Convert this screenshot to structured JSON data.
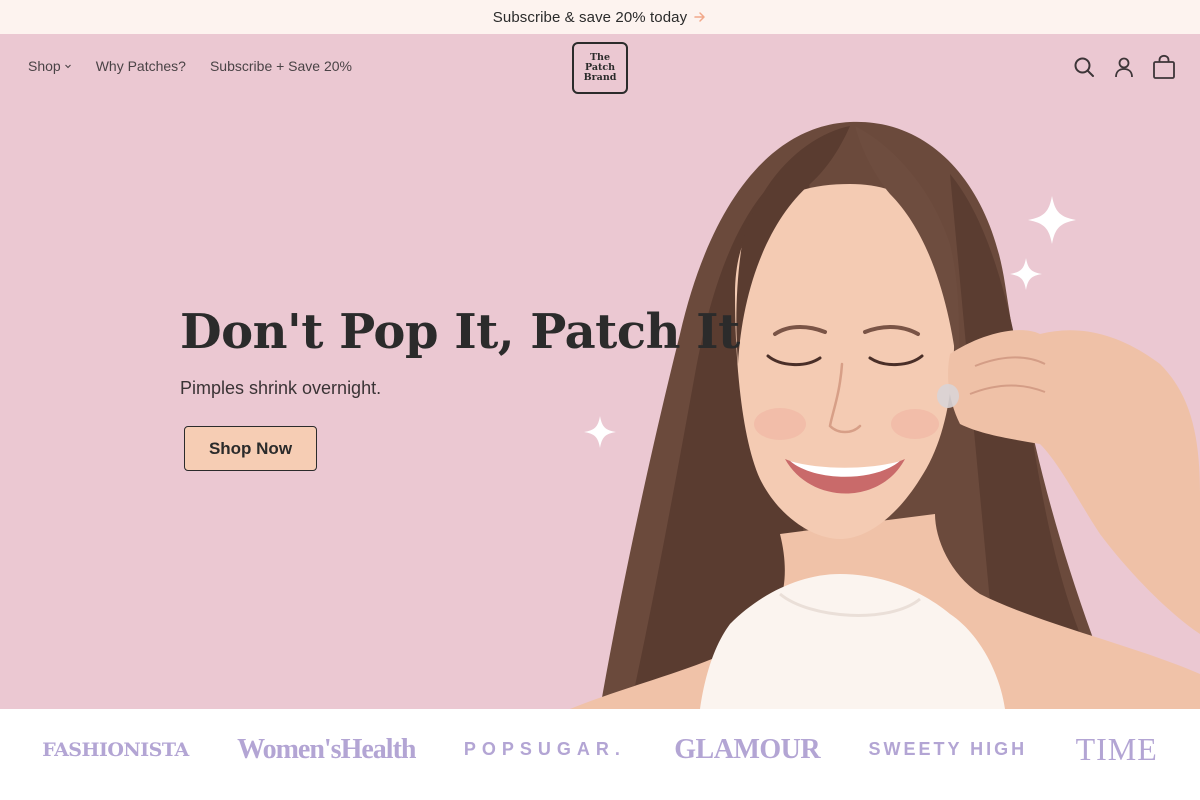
{
  "announcement": {
    "text": "Subscribe & save 20% today",
    "icon": "arrow-right-icon",
    "icon_color": "#f2a88a"
  },
  "header": {
    "nav": [
      {
        "label": "Shop",
        "has_dropdown": true
      },
      {
        "label": "Why Patches?"
      },
      {
        "label": "Subscribe + Save 20%"
      }
    ],
    "logo": {
      "line1": "The",
      "line2": "Patch",
      "line3": "Brand"
    },
    "icons": [
      "search-icon",
      "account-icon",
      "cart-icon"
    ]
  },
  "hero": {
    "headline": "Don't Pop It, Patch It",
    "subheadline": "Pimples shrink overnight.",
    "cta_label": "Shop Now",
    "background_color": "#ebc8d2",
    "cta_color": "#f6cdb4"
  },
  "press": {
    "logos": [
      "FASHIONISTA",
      "Women'sHealth",
      "POPSUGAR.",
      "GLAMOUR",
      "SWEETY HIGH",
      "TIME"
    ],
    "logo_color": "#b3a5d4"
  }
}
